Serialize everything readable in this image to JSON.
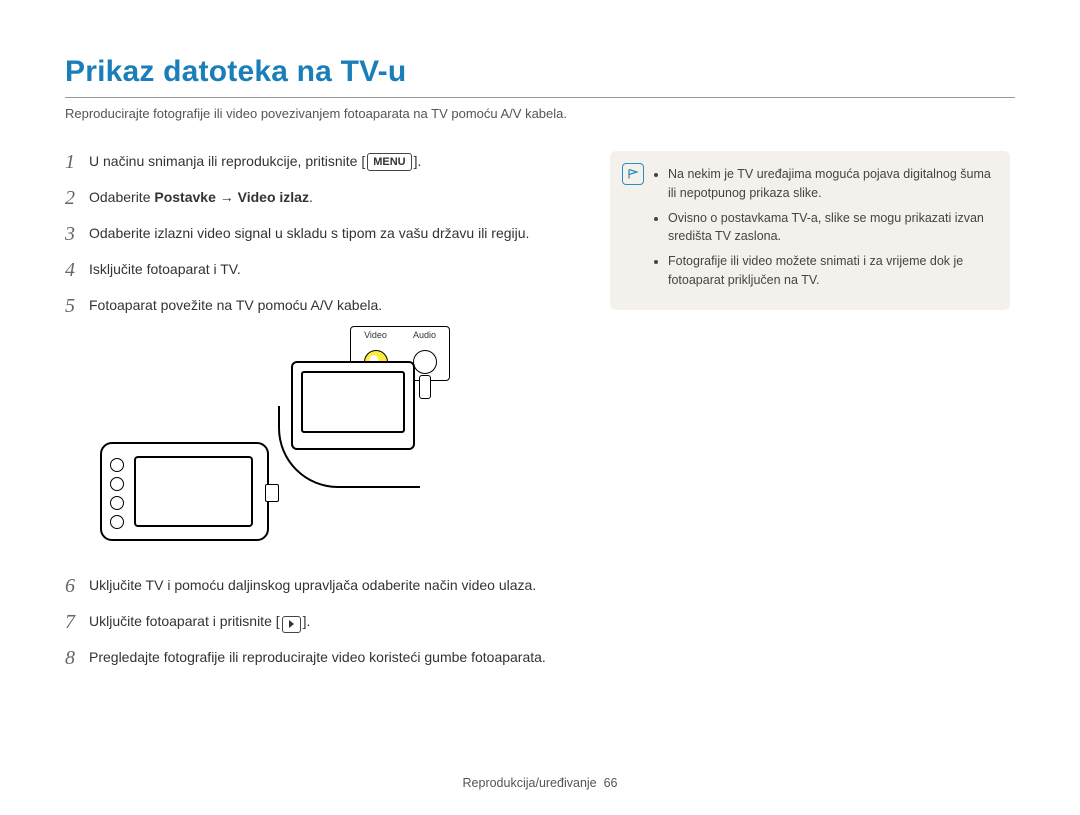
{
  "title": "Prikaz datoteka na TV-u",
  "subtitle": "Reproducirajte fotografije ili video povezivanjem fotoaparata na TV pomoću A/V kabela.",
  "steps": {
    "s1_a": "U načinu snimanja ili reprodukcije, pritisnite [",
    "s1_menu": "MENU",
    "s1_b": "].",
    "s2_a": "Odaberite ",
    "s2_bold": "Postavke → Video izlaz",
    "s2_b": ".",
    "s3": "Odaberite izlazni video signal u skladu s tipom za vašu državu ili regiju.",
    "s4": "Isključite fotoaparat i TV.",
    "s5": "Fotoaparat povežite na TV pomoću A/V kabela.",
    "s6": "Uključite TV i pomoću daljinskog upravljača odaberite način video ulaza.",
    "s7_a": "Uključite fotoaparat i pritisnite [",
    "s7_b": "].",
    "s8": "Pregledajte fotografije ili reproducirajte video koristeći gumbe fotoaparata."
  },
  "diagram": {
    "label_video": "Video",
    "label_audio": "Audio"
  },
  "notes": {
    "n1": "Na nekim je TV uređajima moguća pojava digitalnog šuma ili nepotpunog prikaza slike.",
    "n2": "Ovisno o postavkama TV-a, slike se mogu prikazati izvan središta TV zaslona.",
    "n3": "Fotografije ili video možete snimati i za vrijeme dok je fotoaparat priključen na TV."
  },
  "footer": {
    "section": "Reprodukcija/uređivanje",
    "page": "66"
  }
}
